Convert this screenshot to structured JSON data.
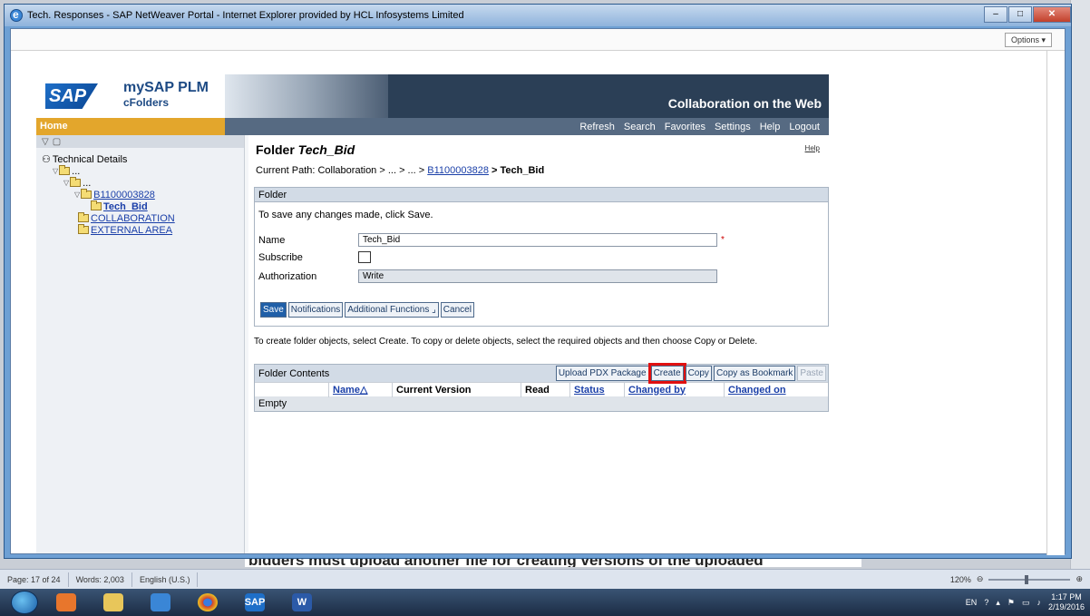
{
  "window": {
    "title": "Tech. Responses - SAP NetWeaver Portal - Internet Explorer provided by HCL Infosystems Limited",
    "options_label": "Options ▾"
  },
  "header": {
    "logo_text": "SAP",
    "product_name": "mySAP PLM",
    "product_sub": "cFolders",
    "title": "Collaboration on the Web"
  },
  "navbar": {
    "home": "Home",
    "links": [
      "Refresh",
      "Search",
      "Favorites",
      "Settings",
      "Help",
      "Logout"
    ]
  },
  "sidebar": {
    "root": "Technical Details",
    "items": [
      {
        "label": "...",
        "link": false
      },
      {
        "label": "...",
        "link": false
      },
      {
        "label": "B1100003828",
        "link": true
      },
      {
        "label": "Tech_Bid",
        "link": true
      },
      {
        "label": "COLLABORATION",
        "link": true
      },
      {
        "label": "EXTERNAL AREA",
        "link": true
      }
    ]
  },
  "content": {
    "title_prefix": "Folder",
    "title_name": "Tech_Bid",
    "help": "Help",
    "path_label": "Current Path:",
    "path_text": "Collaboration > ... > ... >",
    "path_link": "B1100003828",
    "path_current": "> Tech_Bid",
    "panel_title": "Folder",
    "panel_msg": "To save any changes made, click Save.",
    "form": {
      "name_label": "Name",
      "name_value": "Tech_Bid",
      "subscribe_label": "Subscribe",
      "authorization_label": "Authorization",
      "authorization_value": "Write",
      "required_mark": "*"
    },
    "buttons": {
      "save": "Save",
      "notifications": "Notifications",
      "additional": "Additional Functions ⌟",
      "cancel": "Cancel"
    },
    "info_text": "To create folder objects, select Create. To copy or delete objects, select the required objects and then choose Copy or Delete.",
    "table": {
      "title": "Folder Contents",
      "buttons": [
        "Upload PDX Package",
        "Create",
        "Copy",
        "Copy as Bookmark",
        "Paste"
      ],
      "columns": [
        "Name△",
        "Current Version",
        "Read",
        "Status",
        "Changed by",
        "Changed on"
      ],
      "empty": "Empty"
    }
  },
  "word": {
    "doc_text": "bidders must upload another file for creating versions of the uploaded",
    "status": [
      "Page: 17 of 24",
      "Words: 2,003",
      "English (U.S.)"
    ],
    "zoom": "120%"
  },
  "taskbar": {
    "tray_lang": "EN",
    "time": "1:17 PM",
    "date": "2/19/2016"
  }
}
